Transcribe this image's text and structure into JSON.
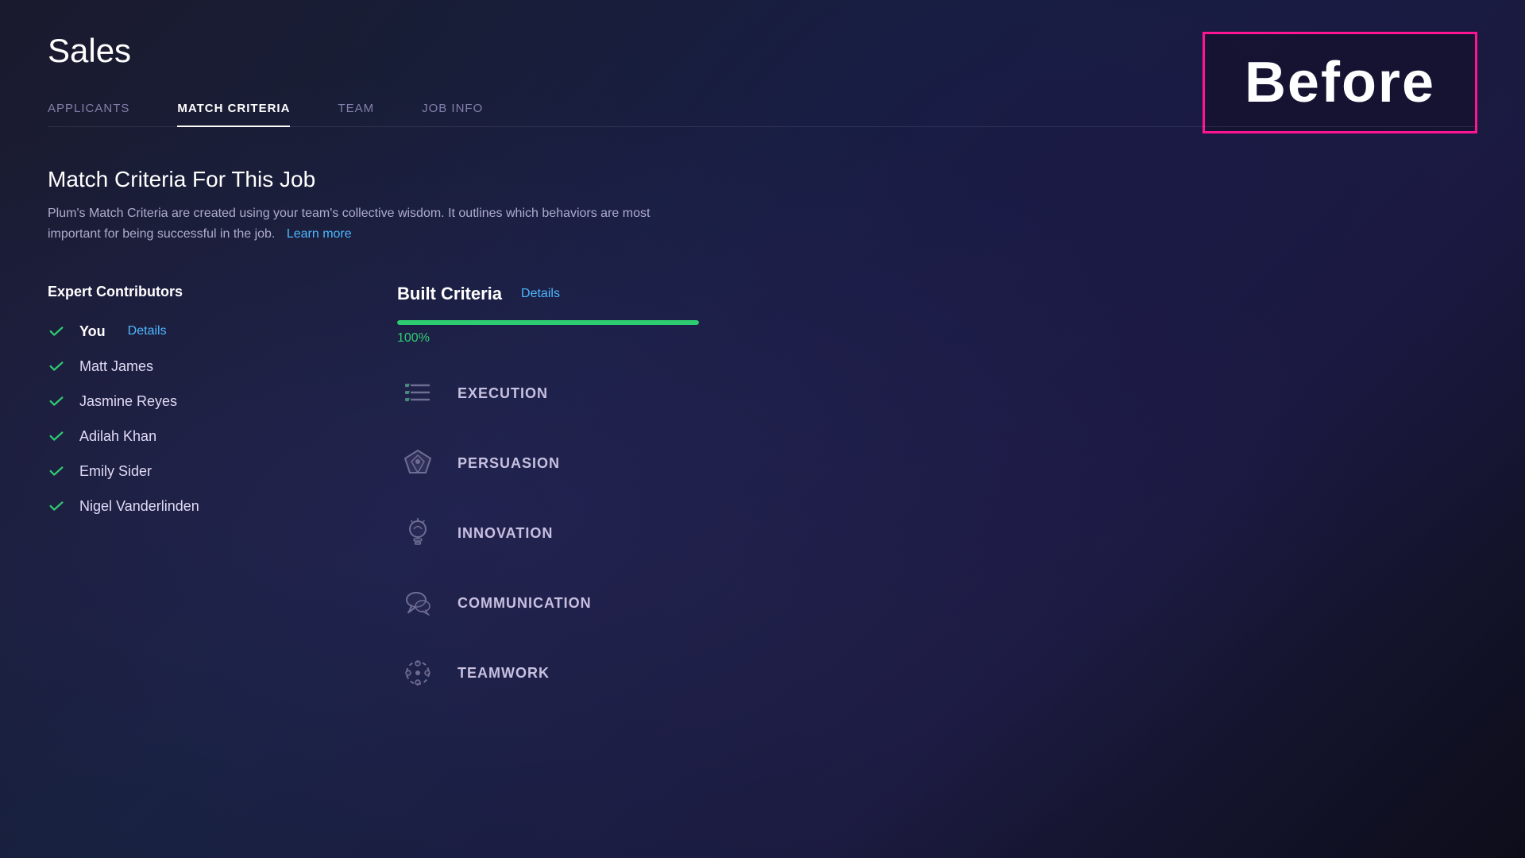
{
  "page": {
    "title": "Sales"
  },
  "tabs": [
    {
      "id": "applicants",
      "label": "APPLICANTS",
      "active": false
    },
    {
      "id": "match-criteria",
      "label": "MATCH CRITERIA",
      "active": true
    },
    {
      "id": "team",
      "label": "TEAM",
      "active": false
    },
    {
      "id": "job-info",
      "label": "JOB INFO",
      "active": false
    }
  ],
  "section": {
    "heading": "Match Criteria For This Job",
    "description": "Plum's Match Criteria are created using your team's collective wisdom. It outlines which behaviors are most important for being successful in the job.",
    "learn_more": "Learn more"
  },
  "contributors": {
    "title": "Expert Contributors",
    "items": [
      {
        "name": "You",
        "is_you": true,
        "has_details": true,
        "details_label": "Details"
      },
      {
        "name": "Matt James",
        "is_you": false,
        "has_details": false
      },
      {
        "name": "Jasmine Reyes",
        "is_you": false,
        "has_details": false
      },
      {
        "name": "Adilah Khan",
        "is_you": false,
        "has_details": false
      },
      {
        "name": "Emily Sider",
        "is_you": false,
        "has_details": false
      },
      {
        "name": "Nigel Vanderlinden",
        "is_you": false,
        "has_details": false
      }
    ]
  },
  "built_criteria": {
    "label": "Built Criteria",
    "details_label": "Details",
    "progress": {
      "percent": 100,
      "display": "100%",
      "color": "#2ecc71"
    },
    "items": [
      {
        "id": "execution",
        "name": "EXECUTION",
        "icon": "checklist"
      },
      {
        "id": "persuasion",
        "name": "PERSUASION",
        "icon": "filter"
      },
      {
        "id": "innovation",
        "name": "INNOVATION",
        "icon": "lightbulb"
      },
      {
        "id": "communication",
        "name": "COMMUNICATION",
        "icon": "chat"
      },
      {
        "id": "teamwork",
        "name": "TEAMWORK",
        "icon": "dots-circle"
      }
    ]
  },
  "before_label": {
    "text": "Before",
    "border_color": "#ff1493"
  }
}
